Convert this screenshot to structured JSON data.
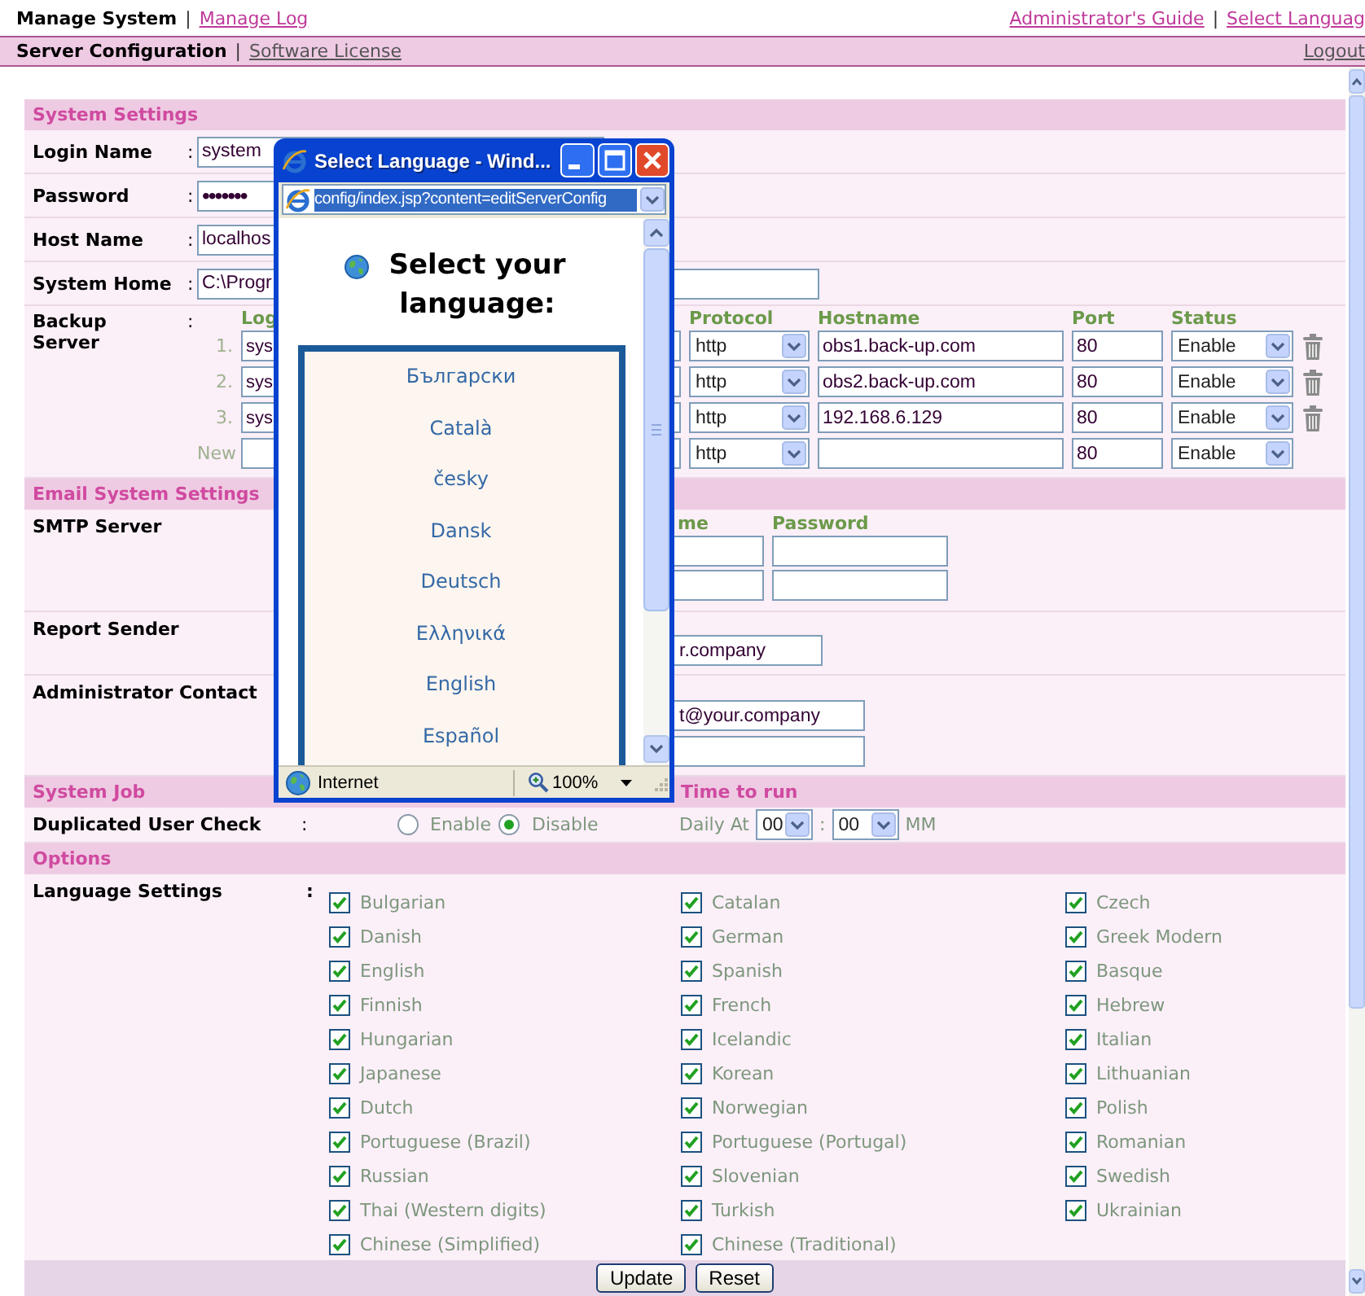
{
  "top_nav": {
    "left": {
      "items": [
        {
          "label": "Manage System",
          "selected": true
        },
        {
          "label": "Manage Log",
          "selected": false
        }
      ],
      "separator": "|"
    },
    "right": {
      "items": [
        {
          "label": "Administrator's Guide"
        },
        {
          "label": "Select Languag"
        }
      ],
      "separator": "|"
    }
  },
  "sub_nav": {
    "left": {
      "items": [
        {
          "label": "Server Configuration",
          "selected": true
        },
        {
          "label": "Software License",
          "selected": false
        }
      ],
      "separator": "|"
    },
    "logout": "Logout"
  },
  "system_settings": {
    "title": "System Settings",
    "fields": [
      {
        "label": "Login Name",
        "colon": ":",
        "kind": "text",
        "value": "system"
      },
      {
        "label": "Password",
        "colon": ":",
        "kind": "password",
        "value": "•••••••"
      },
      {
        "label": "Host Name",
        "colon": ":",
        "kind": "text",
        "value": "localhos"
      },
      {
        "label": "System Home",
        "colon": ":",
        "kind": "text",
        "value": "C:\\Progr"
      }
    ],
    "backup_server": {
      "label": "Backup Server",
      "colon": ":",
      "columns": [
        "Log",
        "Protocol",
        "Hostname",
        "Port",
        "Status"
      ],
      "rows": [
        {
          "number": "1.",
          "login": "sys",
          "protocol": "http",
          "hostname": "obs1.back-up.com",
          "port": "80",
          "status": "Enable",
          "deletable": true
        },
        {
          "number": "2.",
          "login": "sys",
          "protocol": "http",
          "hostname": "obs2.back-up.com",
          "port": "80",
          "status": "Enable",
          "deletable": true
        },
        {
          "number": "3.",
          "login": "sys",
          "protocol": "http",
          "hostname": "192.168.6.129",
          "port": "80",
          "status": "Enable",
          "deletable": true
        },
        {
          "number": "New",
          "protocol": "http",
          "port": "80",
          "status": "Enable",
          "deletable": false
        }
      ]
    }
  },
  "email_settings": {
    "title": "Email System Settings",
    "smtp_server": {
      "label": "SMTP Server",
      "columns": [
        "me",
        "Password"
      ],
      "rows": [
        {
          "kind": "blank"
        },
        {
          "kind": "blank"
        }
      ]
    },
    "report_sender": {
      "label": "Report Sender",
      "value": "r.company"
    },
    "administrator_contact": {
      "label": "Administrator Contact",
      "fields": [
        {
          "kind": "text",
          "value": "t@your.company"
        },
        {
          "kind": "blank"
        }
      ]
    }
  },
  "system_job": {
    "title": "System Job",
    "time_title": "Time to run",
    "duplicated_user_check": {
      "label": "Duplicated User Check",
      "colon": ":",
      "options": [
        {
          "label": "Enable",
          "selected": false
        },
        {
          "label": "Disable",
          "selected": true
        }
      ],
      "daily_at": "Daily At",
      "hour": "00",
      "time_separator": ":",
      "minute": "00",
      "unit": "MM"
    }
  },
  "options": {
    "title": "Options",
    "language_settings": {
      "label": "Language Settings",
      "colon": ":",
      "languages": [
        {
          "label": "Bulgarian",
          "checked": true
        },
        {
          "label": "Catalan",
          "checked": true
        },
        {
          "label": "Czech",
          "checked": true
        },
        {
          "label": "Danish",
          "checked": true
        },
        {
          "label": "German",
          "checked": true
        },
        {
          "label": "Greek Modern",
          "checked": true
        },
        {
          "label": "English",
          "checked": true
        },
        {
          "label": "Spanish",
          "checked": true
        },
        {
          "label": "Basque",
          "checked": true
        },
        {
          "label": "Finnish",
          "checked": true
        },
        {
          "label": "French",
          "checked": true
        },
        {
          "label": "Hebrew",
          "checked": true
        },
        {
          "label": "Hungarian",
          "checked": true
        },
        {
          "label": "Icelandic",
          "checked": true
        },
        {
          "label": "Italian",
          "checked": true
        },
        {
          "label": "Japanese",
          "checked": true
        },
        {
          "label": "Korean",
          "checked": true
        },
        {
          "label": "Lithuanian",
          "checked": true
        },
        {
          "label": "Dutch",
          "checked": true
        },
        {
          "label": "Norwegian",
          "checked": true
        },
        {
          "label": "Polish",
          "checked": true
        },
        {
          "label": "Portuguese (Brazil)",
          "checked": true
        },
        {
          "label": "Portuguese (Portugal)",
          "checked": true
        },
        {
          "label": "Romanian",
          "checked": true
        },
        {
          "label": "Russian",
          "checked": true
        },
        {
          "label": "Slovenian",
          "checked": true
        },
        {
          "label": "Swedish",
          "checked": true
        },
        {
          "label": "Thai (Western digits)",
          "checked": true
        },
        {
          "label": "Turkish",
          "checked": true
        },
        {
          "label": "Ukrainian",
          "checked": true
        },
        {
          "label": "Chinese (Simplified)",
          "checked": true
        },
        {
          "label": "Chinese (Traditional)",
          "checked": true
        }
      ]
    }
  },
  "buttons": [
    "Update",
    "Reset"
  ],
  "popup": {
    "title": "Select Language - Wind...",
    "address": "config/index.jsp?content=editServerConfig",
    "heading": "Select your language:",
    "languages": [
      "Български",
      "Català",
      "česky",
      "Dansk",
      "Deutsch",
      "Ελληνικά",
      "English",
      "Español"
    ],
    "status": "Internet",
    "zoom": "100%"
  }
}
